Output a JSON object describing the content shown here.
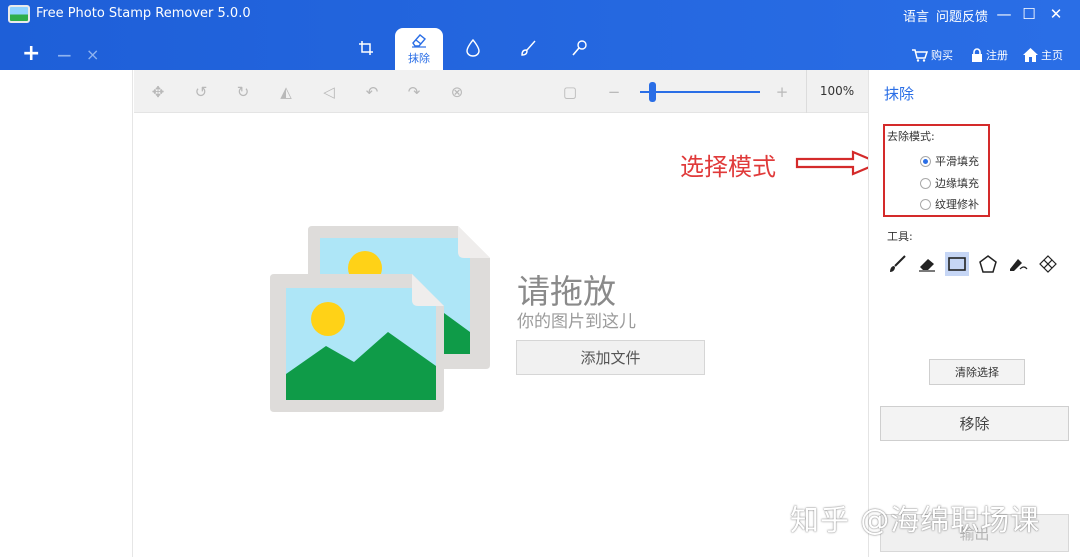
{
  "window": {
    "title": "Free Photo Stamp Remover 5.0.0",
    "menu_language": "语言",
    "menu_feedback": "问题反馈",
    "minimize_icon": "—",
    "maximize_icon": "☐",
    "close_icon": "✕"
  },
  "file_toolbar": {
    "add": "+",
    "remove": "−",
    "close": "×"
  },
  "mode_tabs": [
    {
      "name": "crop",
      "label": ""
    },
    {
      "name": "erase",
      "label": "抹除"
    },
    {
      "name": "drop",
      "label": ""
    },
    {
      "name": "brush",
      "label": ""
    },
    {
      "name": "stamp",
      "label": ""
    }
  ],
  "top_right": {
    "buy": "购买",
    "register": "注册",
    "home": "主页"
  },
  "edit_toolbar": {
    "zoom_percent": "100%",
    "zoom_level": 0.1
  },
  "canvas": {
    "drop_title": "请拖放",
    "drop_subtitle": "你的图片到这儿",
    "add_file": "添加文件"
  },
  "annotation": {
    "text": "选择模式"
  },
  "right_panel": {
    "title": "抹除",
    "mode_label": "去除模式:",
    "modes": [
      {
        "label": "平滑填充",
        "checked": true
      },
      {
        "label": "边缘填充",
        "checked": false
      },
      {
        "label": "纹理修补",
        "checked": false
      }
    ],
    "tools_label": "工具:",
    "clear_selection": "清除选择",
    "remove": "移除",
    "output": "输出"
  },
  "watermark": "知乎 @海绵职场课",
  "colors": {
    "accent": "#2a6ee6",
    "annotation": "#e03a3a"
  }
}
